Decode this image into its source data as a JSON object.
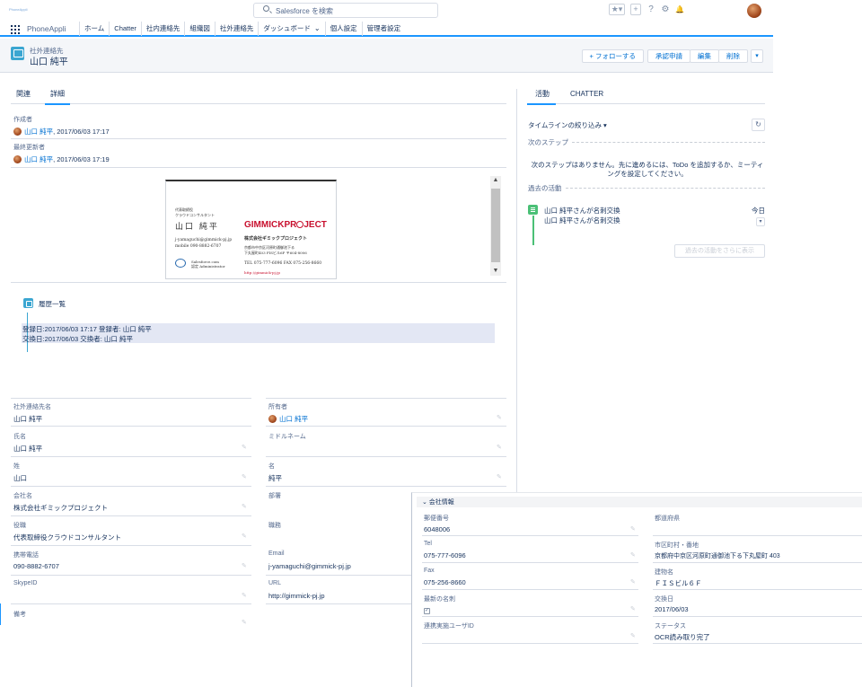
{
  "topbar": {
    "logo_text": "PhoneAppli",
    "search_placeholder": "Salesforce を検索",
    "star": "★▾",
    "plus": "+",
    "help": "?",
    "gear": "⚙",
    "bell": "🔔"
  },
  "nav": {
    "app_name": "PhoneAppli",
    "items": [
      "ホーム",
      "Chatter",
      "社内連絡先",
      "組織図",
      "社外連絡先",
      "ダッシュボード",
      "個人設定",
      "管理者設定"
    ]
  },
  "header": {
    "object_type": "社外連絡先",
    "record_name": "山口 純平",
    "buttons": {
      "follow": "+ フォローする",
      "approval": "承認申請",
      "edit": "編集",
      "delete": "削除",
      "more": "▾"
    }
  },
  "left_tabs": [
    "関連",
    "詳細"
  ],
  "system_info": {
    "created_label": "作成者",
    "created_user": "山口 純平",
    "created_date": ", 2017/06/03 17:17",
    "modified_label": "最終更新者",
    "modified_user": "山口 純平",
    "modified_date": ", 2017/06/03 17:19"
  },
  "card": {
    "title_small": "代表取締役",
    "title_small2": "クラウドコンサルタント",
    "name": "山口 純平",
    "email": "j-yamaguchi@gimmick-pj.jp",
    "mobile": "mobile 090-8882-6707",
    "brand_a": "GIMMICKPR",
    "brand_b": "JECT",
    "company": "株式会社ギミックプロジェクト",
    "address1": "京都市中京区河原町通御池下る",
    "address2": "下丸屋町403 FISビル6F 〒604-8006",
    "tel": "TEL 075-777-6096   FAX 075-256-8660",
    "url": "http://gimmick-pj.jp",
    "sf_line1": "Salesforce.com",
    "sf_line2": "認定 Administrator"
  },
  "history": {
    "title": "履歴一覧",
    "line1": "登録日:2017/06/03 17:17 登録者: 山口 純平",
    "line2": "交換日:2017/06/03 交換者: 山口 純平"
  },
  "fields": {
    "contact_name_label": "社外連絡先名",
    "contact_name": "山口 純平",
    "owner_label": "所有者",
    "owner": "山口 純平",
    "fullname_label": "氏名",
    "fullname": "山口 純平",
    "middle_label": "ミドルネーム",
    "middle": "",
    "last_label": "姓",
    "last": "山口",
    "first_label": "名",
    "first": "純平",
    "company_label": "会社名",
    "company": "株式会社ギミックプロジェクト",
    "dept_label": "部署",
    "dept": "",
    "title_label": "役職",
    "title": "代表取締役クラウドコンサルタント",
    "position_label": "職務",
    "position": "",
    "mobile_label": "携帯電話",
    "mobile": "090-8882-6707",
    "email_label": "Email",
    "email": "j-yamaguchi@gimmick-pj.jp",
    "skype_label": "SkypeID",
    "skype": "",
    "url_label": "URL",
    "url": "http://gimmick-pj.jp",
    "note_label": "備考",
    "note": ""
  },
  "activity": {
    "tabs": [
      "活動",
      "CHATTER"
    ],
    "filter": "タイムラインの絞り込み ▾",
    "refresh": "↻",
    "next_steps": "次のステップ",
    "empty_msg1": "次のステップはありません。先に進めるには、ToDo を追加するか、ミーティ",
    "empty_msg2": "ングを設定してください。",
    "past": "過去の活動",
    "item_title": "山口 純平さんが名刺交換",
    "item_date": "今日",
    "item_sub": "山口 純平さんが名刺交換",
    "more": "過去の活動をさらに表示"
  },
  "company_info": {
    "section": "⌄ 会社情報",
    "postal_label": "郵便番号",
    "postal": "6048006",
    "prefecture_label": "都道府県",
    "prefecture": "",
    "tel_label": "Tel",
    "tel": "075-777-6096",
    "city_label": "市区町村・番地",
    "city": "京都府中京区河原町通御池下る下丸屋町 403",
    "fax_label": "Fax",
    "fax": "075-256-8660",
    "building_label": "建物名",
    "building": "ＦＩＳビル６Ｆ",
    "latest_label": "最新の名刺",
    "latest": "✓",
    "exchange_label": "交換日",
    "exchange": "2017/06/03",
    "linked_label": "連携実施ユーザID",
    "linked": "",
    "status_label": "ステータス",
    "status": "OCR読み取り完了"
  },
  "colors": {
    "brand_blue": "#1b96ff",
    "link": "#0070d2",
    "text": "#16325c",
    "card_red": "#c8102e"
  }
}
